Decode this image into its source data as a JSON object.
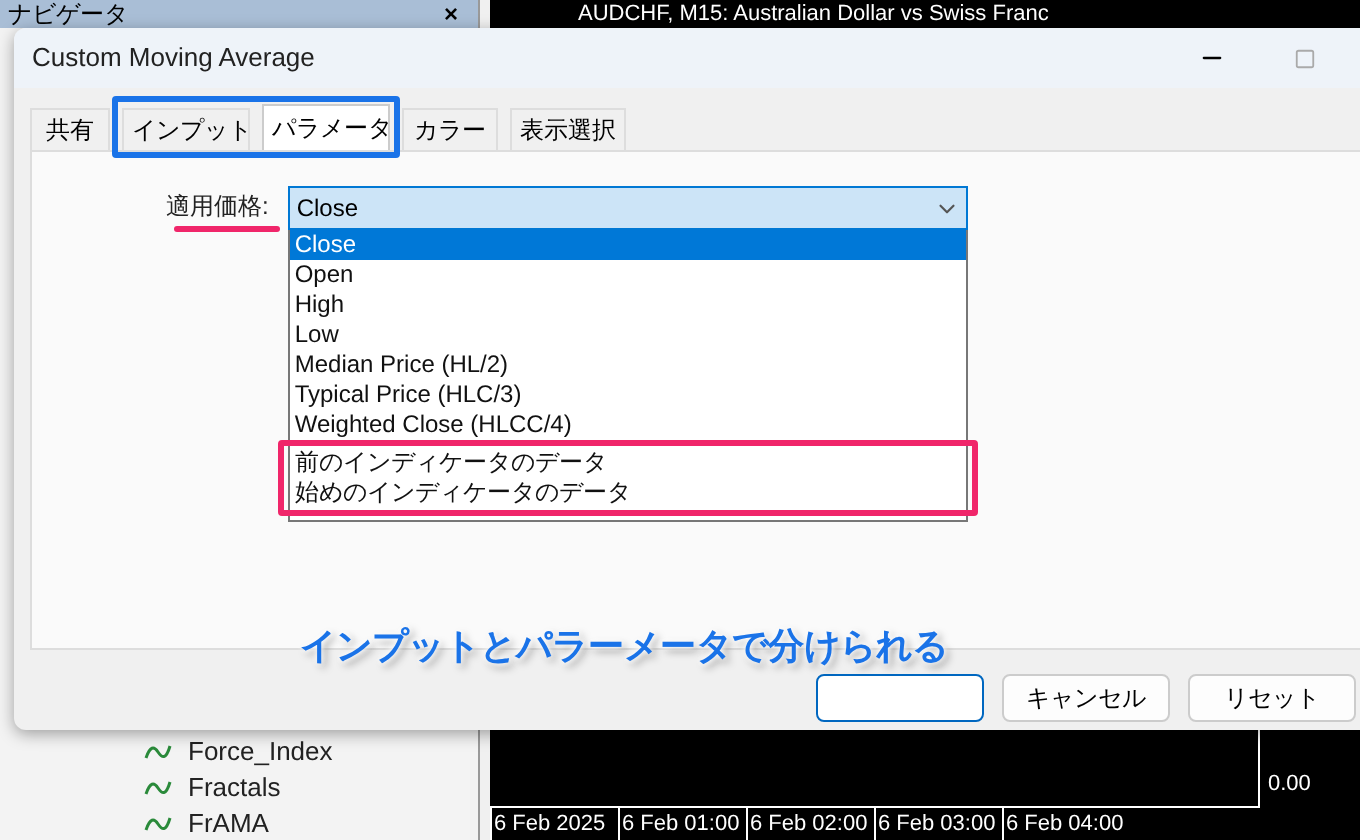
{
  "navigator": {
    "title": "ナビゲータ",
    "close": "×",
    "items": [
      {
        "label": "Force_Index"
      },
      {
        "label": "Fractals"
      },
      {
        "label": "FrAMA"
      }
    ]
  },
  "chart": {
    "title": "AUDCHF, M15: Australian Dollar vs Swiss Franc",
    "price_labels": [
      "0.00"
    ],
    "time_labels": [
      "6 Feb 2025",
      "6 Feb 01:00",
      "6 Feb 02:00",
      "6 Feb 03:00",
      "6 Feb 04:00"
    ]
  },
  "dialog": {
    "title": "Custom Moving Average",
    "tabs": [
      {
        "label": "共有",
        "selected": false
      },
      {
        "label": "インプット",
        "selected": false
      },
      {
        "label": "パラメータ",
        "selected": true
      },
      {
        "label": "カラー",
        "selected": false
      },
      {
        "label": "表示選択",
        "selected": false
      }
    ],
    "field_label": "適用価格:",
    "select_value": "Close",
    "options": [
      {
        "label": "Close",
        "selected": true
      },
      {
        "label": "Open",
        "selected": false
      },
      {
        "label": "High",
        "selected": false
      },
      {
        "label": "Low",
        "selected": false
      },
      {
        "label": "Median Price (HL/2)",
        "selected": false
      },
      {
        "label": "Typical Price (HLC/3)",
        "selected": false
      },
      {
        "label": "Weighted Close (HLCC/4)",
        "selected": false
      }
    ],
    "highlighted_options": [
      {
        "label": "前のインディケータのデータ",
        "selected": false
      },
      {
        "label": "始めのインディケータのデータ",
        "selected": false
      }
    ],
    "buttons": [
      "キャンセル",
      "リセット"
    ]
  },
  "annotation": {
    "caption": "インプットとパラーメータで分けられる"
  }
}
